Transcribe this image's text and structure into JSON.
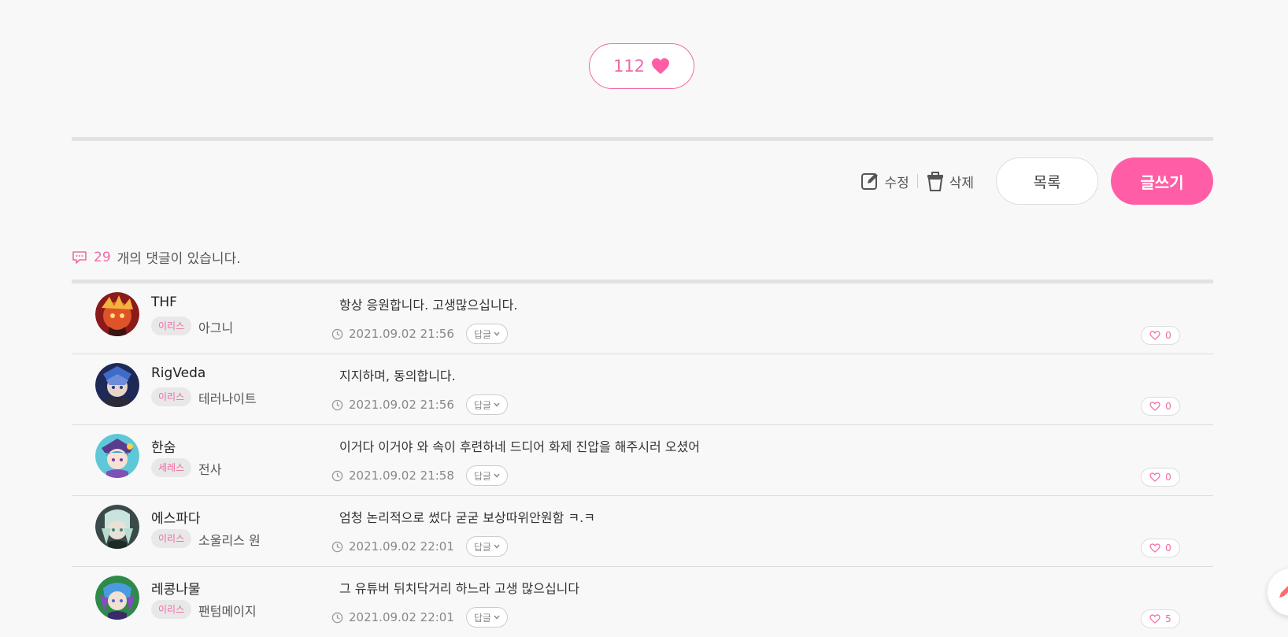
{
  "post": {
    "like_count": "112"
  },
  "actions": {
    "edit_label": "수정",
    "delete_label": "삭제",
    "list_label": "목록",
    "write_label": "글쓰기"
  },
  "comments_header": {
    "count": "29",
    "text": "개의 댓글이 있습니다."
  },
  "reply_label": "답글",
  "colors": {
    "accent": "#f06aa5",
    "write_button": "#ff5ea6",
    "background": "#f8f8f8"
  },
  "comments": [
    {
      "username": "THF",
      "server": "이리스",
      "job": "아그니",
      "text": "항상 응원합니다. 고생많으십니다.",
      "date": "2021.09.02 21:56",
      "likes": "0"
    },
    {
      "username": "RigVeda",
      "server": "이리스",
      "job": "테러나이트",
      "text": "지지하며, 동의합니다.",
      "date": "2021.09.02 21:56",
      "likes": "0"
    },
    {
      "username": "한숨",
      "server": "세레스",
      "job": "전사",
      "text": "이거다 이거야 와 속이 후련하네 드디어 화제 진압을 해주시러 오셨어",
      "date": "2021.09.02 21:58",
      "likes": "0"
    },
    {
      "username": "에스파다",
      "server": "이리스",
      "job": "소울리스 원",
      "text": "엄청 논리적으로 썼다 굳굳 보상따위안원함 ㅋ.ㅋ",
      "date": "2021.09.02 22:01",
      "likes": "0"
    },
    {
      "username": "레콩나물",
      "server": "이리스",
      "job": "팬텀메이지",
      "text": "그 유튜버 뒤치닥거리 하느라 고생 많으십니다",
      "date": "2021.09.02 22:01",
      "likes": "5"
    }
  ]
}
